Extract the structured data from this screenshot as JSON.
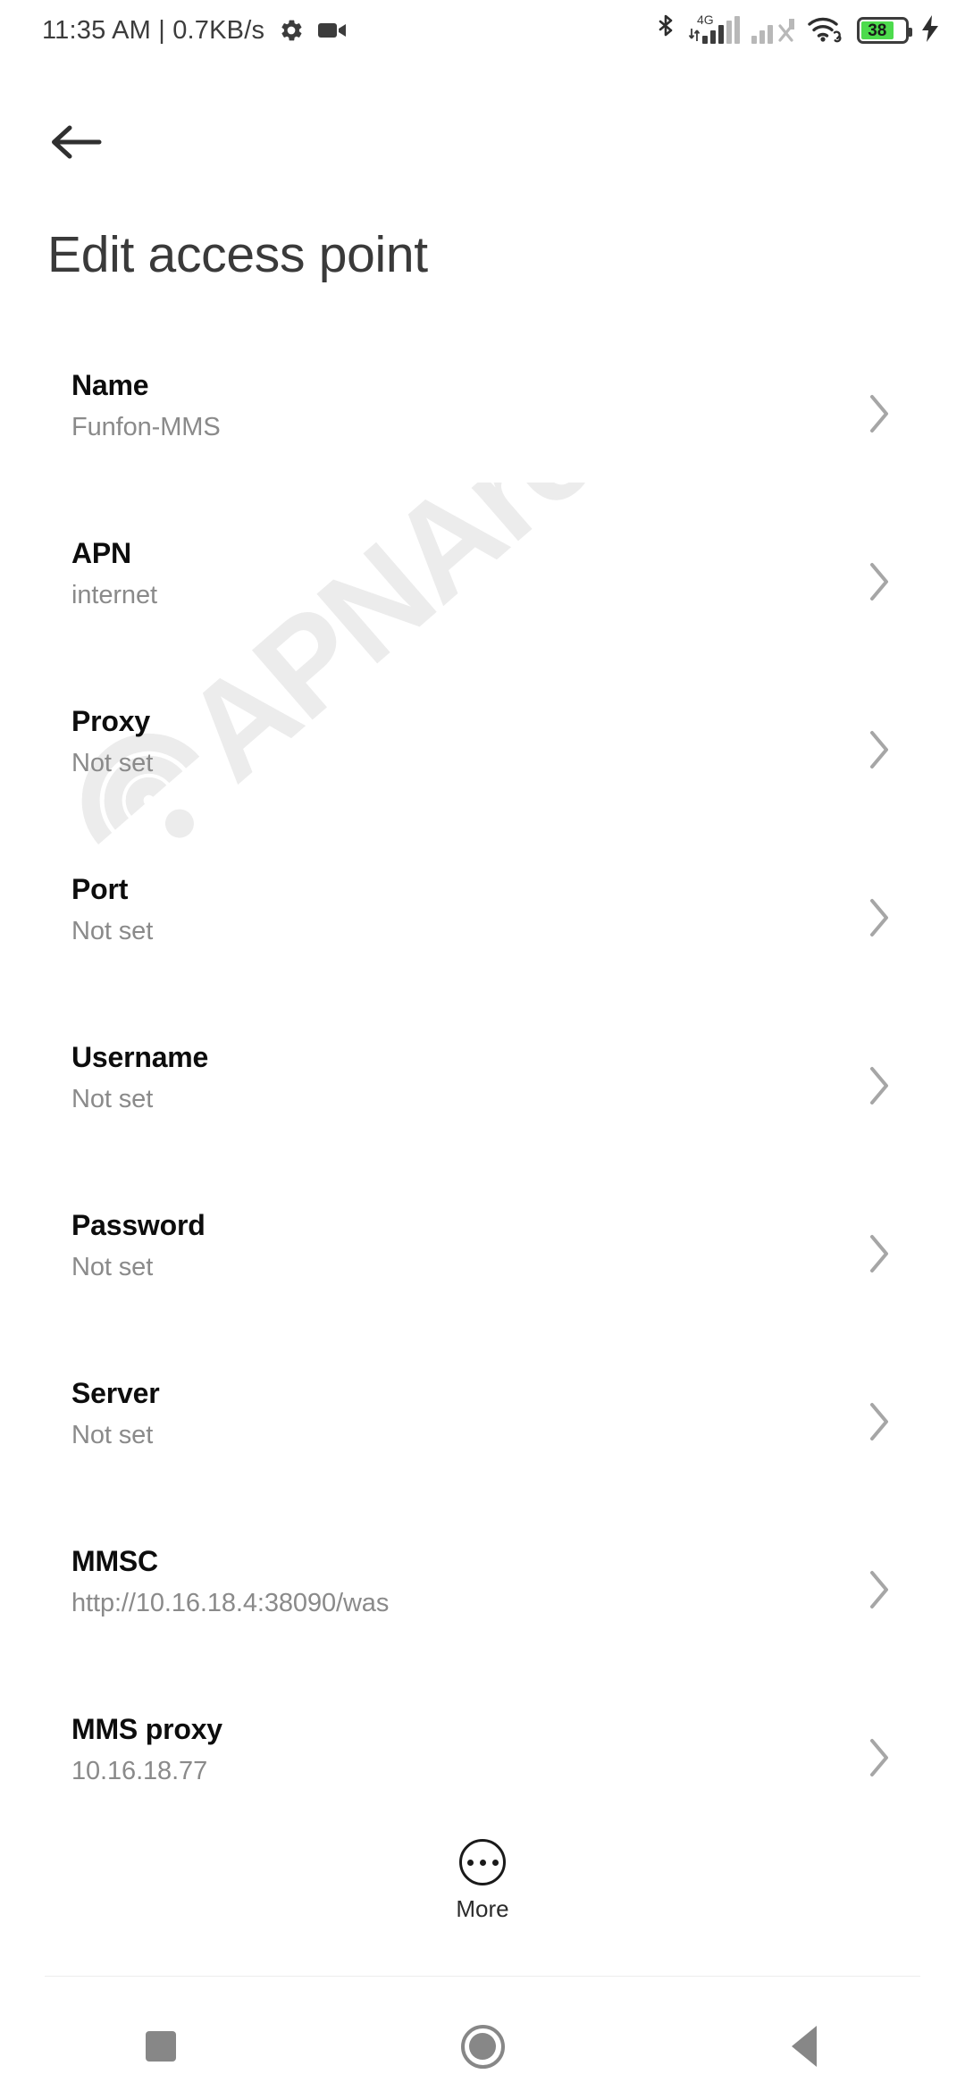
{
  "status_bar": {
    "clock": "11:35 AM | 0.7KB/s",
    "gear_icon": "gear-icon",
    "camcorder_icon": "camcorder-icon",
    "bluetooth_icon": "bluetooth-icon",
    "network_label": "4G",
    "sim1_icon": "signal-bars-icon",
    "sim2_icon": "signal-bars-no-service-icon",
    "wifi_icon": "wifi-link-icon",
    "battery_level": "38",
    "battery_color": "#4ddb4d",
    "charging_icon": "charging-bolt-icon"
  },
  "header": {
    "back_icon": "arrow-left-icon",
    "title": "Edit access point"
  },
  "watermark": {
    "text": "APNArena",
    "color": "#ececec"
  },
  "settings": {
    "chevron_icon": "chevron-right-icon",
    "rows": [
      {
        "label": "Name",
        "value": "Funfon-MMS"
      },
      {
        "label": "APN",
        "value": "internet"
      },
      {
        "label": "Proxy",
        "value": "Not set"
      },
      {
        "label": "Port",
        "value": "Not set"
      },
      {
        "label": "Username",
        "value": "Not set"
      },
      {
        "label": "Password",
        "value": "Not set"
      },
      {
        "label": "Server",
        "value": "Not set"
      },
      {
        "label": "MMSC",
        "value": "http://10.16.18.4:38090/was"
      },
      {
        "label": "MMS proxy",
        "value": "10.16.18.77"
      }
    ]
  },
  "more_button": {
    "label": "More",
    "icon": "more-horizontal-circle-icon"
  },
  "nav_bar": {
    "recents": "square-recents-icon",
    "home": "circle-home-icon",
    "back": "triangle-back-icon",
    "color": "#878787"
  }
}
